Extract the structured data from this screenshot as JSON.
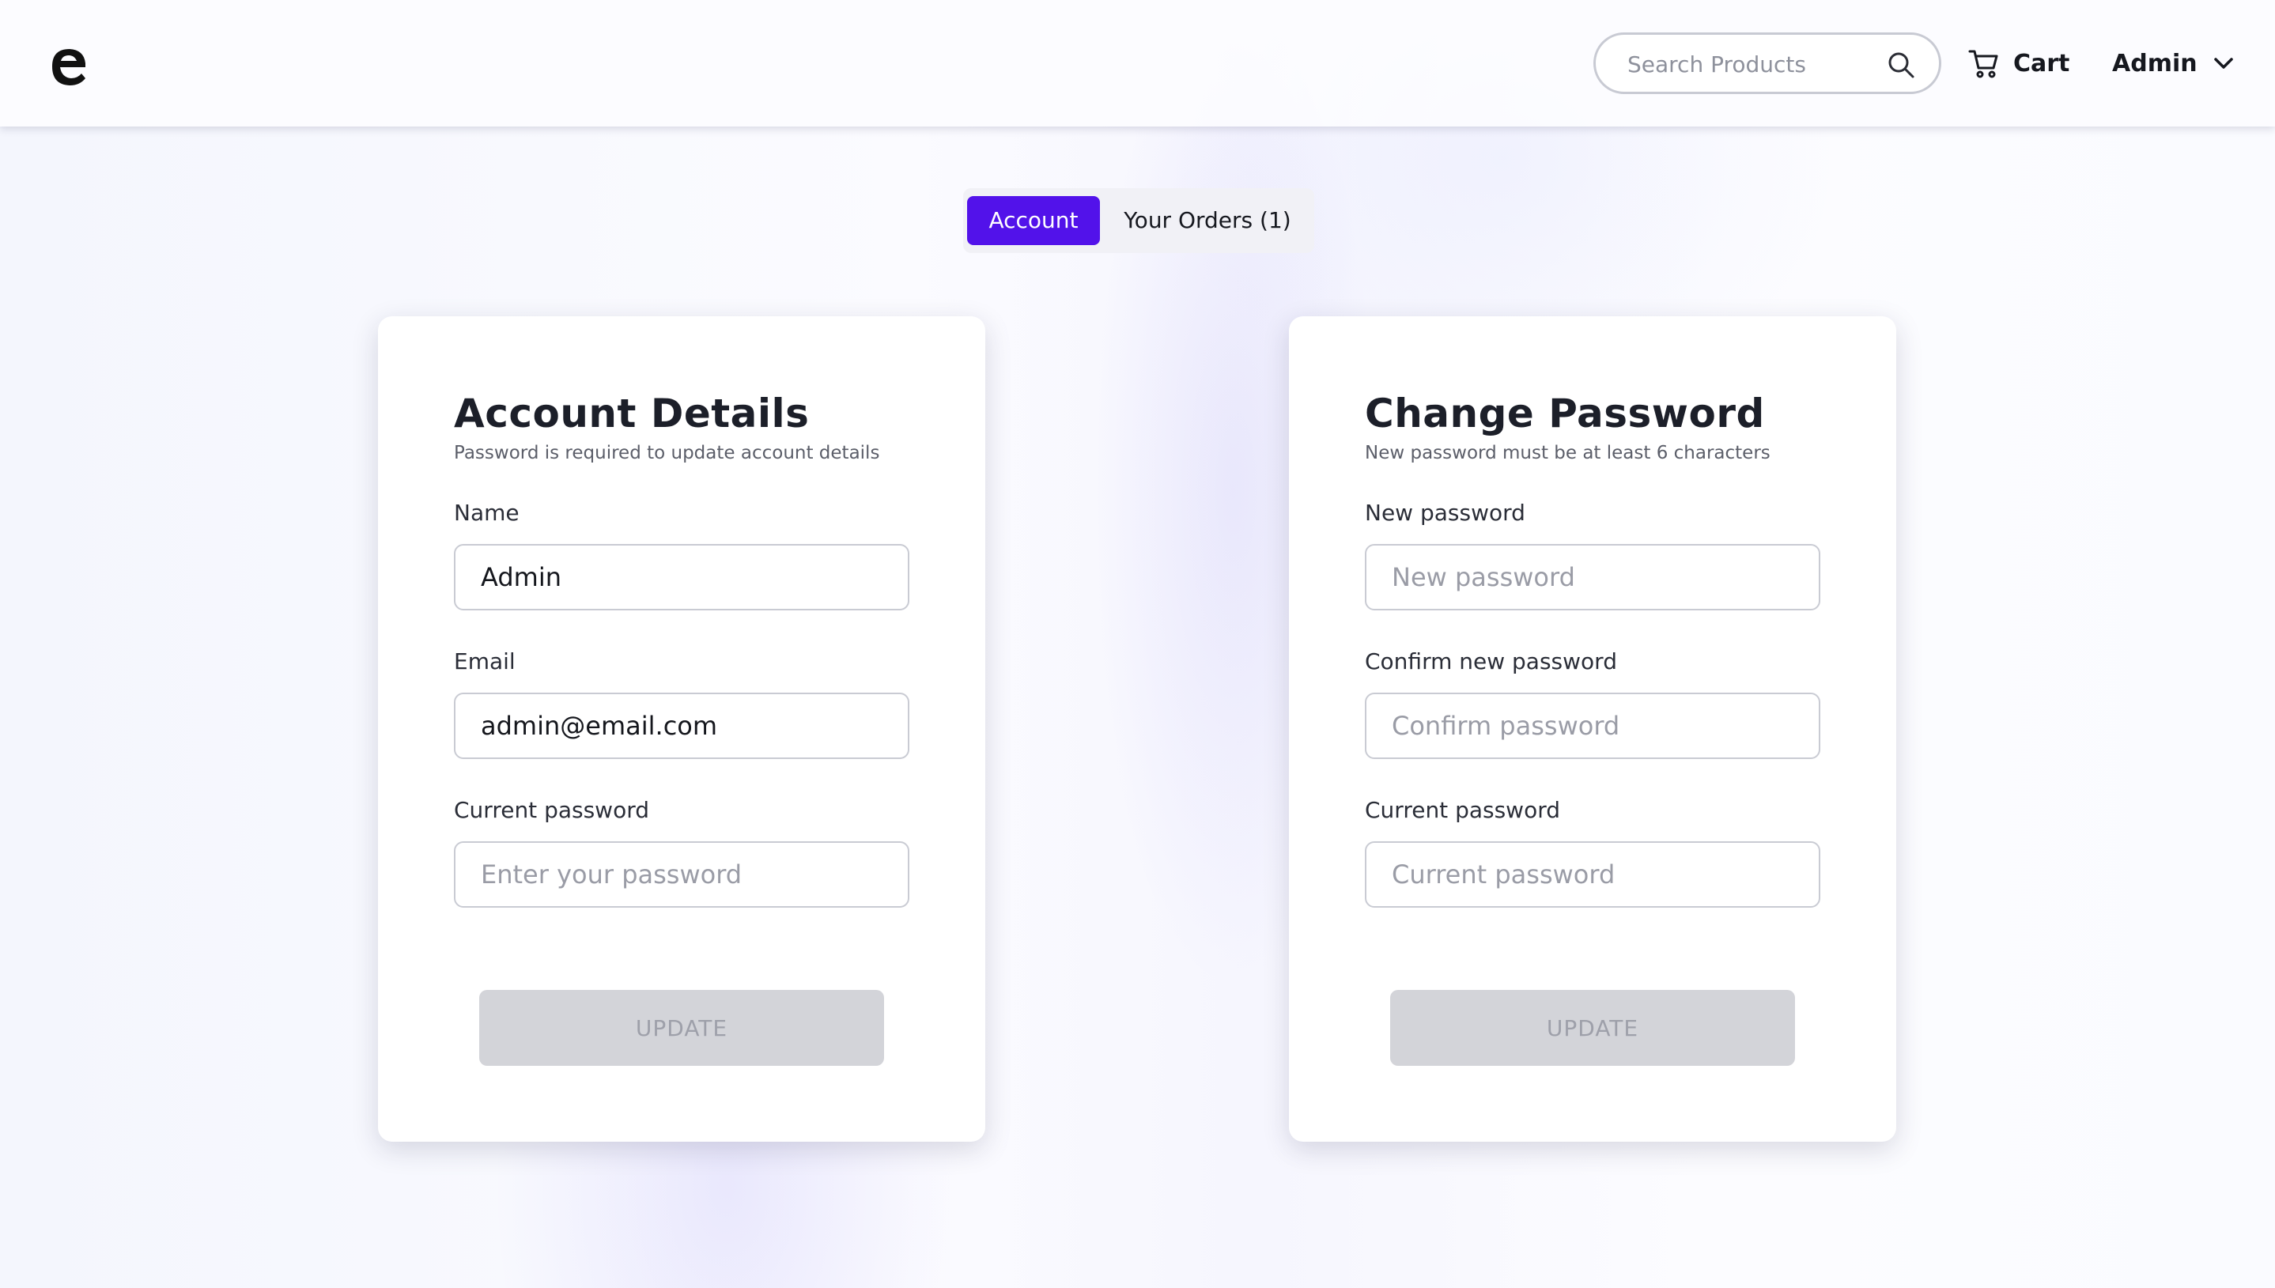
{
  "header": {
    "logo_icon": "brand-e-logo-icon",
    "search": {
      "placeholder": "Search Products",
      "value": "",
      "icon": "search-icon"
    },
    "cart": {
      "label": "Cart",
      "icon": "cart-icon"
    },
    "user_menu": {
      "label": "Admin",
      "icon": "chevron-down-icon"
    }
  },
  "tabs": [
    {
      "label": "Account",
      "active": true
    },
    {
      "label": "Your Orders (1)",
      "active": false
    }
  ],
  "account_details": {
    "title": "Account Details",
    "subtitle": "Password is required to update account details",
    "fields": [
      {
        "label": "Name",
        "value": "Admin",
        "placeholder": ""
      },
      {
        "label": "Email",
        "value": "admin@email.com",
        "placeholder": ""
      },
      {
        "label": "Current password",
        "value": "",
        "placeholder": "Enter your password"
      }
    ],
    "button_label": "UPDATE"
  },
  "change_password": {
    "title": "Change Password",
    "subtitle": "New password must be at least 6 characters",
    "fields": [
      {
        "label": "New password",
        "value": "",
        "placeholder": "New password"
      },
      {
        "label": "Confirm new password",
        "value": "",
        "placeholder": "Confirm password"
      },
      {
        "label": "Current password",
        "value": "",
        "placeholder": "Current password"
      }
    ],
    "button_label": "UPDATE"
  },
  "colors": {
    "accent": "#5212ea",
    "button_disabled_bg": "#d3d4d9",
    "button_disabled_text": "#9ea0aa"
  }
}
